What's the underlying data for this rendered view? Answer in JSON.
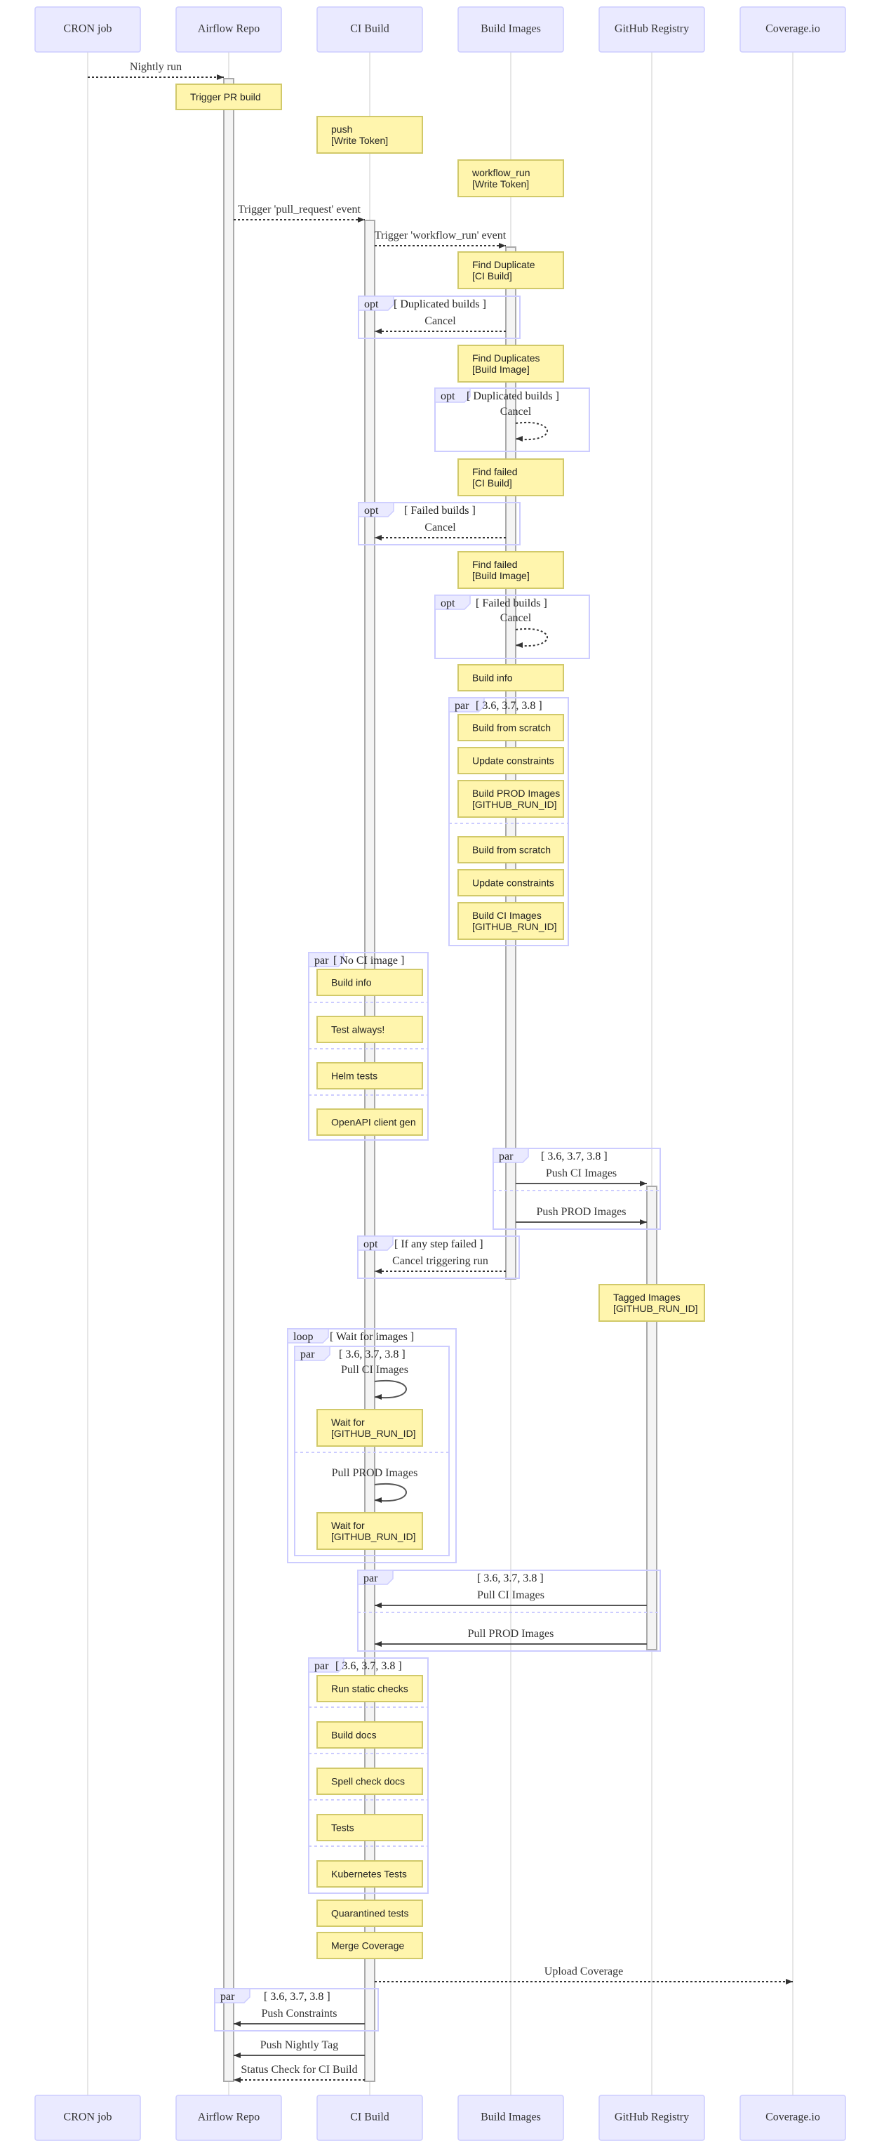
{
  "participants": [
    "CRON job",
    "Airflow Repo",
    "CI Build",
    "Build Images",
    "GitHub Registry",
    "Coverage.io"
  ],
  "messages": {
    "nightly_run": "Nightly run",
    "trigger_pr": "Trigger 'pull_request' event",
    "trigger_workflow": "Trigger 'workflow_run' event",
    "cancel": "Cancel",
    "push_ci_images": "Push CI Images",
    "push_prod_images": "Push PROD Images",
    "cancel_triggering_run": "Cancel triggering run",
    "pull_ci_images": "Pull CI Images",
    "pull_prod_images": "Pull PROD Images",
    "upload_coverage": "Upload Coverage",
    "push_constraints": "Push Constraints",
    "push_nightly_tag": "Push Nightly Tag",
    "status_check": "Status Check for CI Build"
  },
  "notes": {
    "trigger_pr_build": [
      "Trigger PR build"
    ],
    "push_write_token": [
      "push",
      "[Write Token]"
    ],
    "workflow_run_write_token": [
      "workflow_run",
      "[Write Token]"
    ],
    "find_duplicate_ci": [
      "Find Duplicate",
      "[CI Build]"
    ],
    "find_duplicates_image": [
      "Find Duplicates",
      "[Build Image]"
    ],
    "find_failed_ci": [
      "Find failed",
      "[CI Build]"
    ],
    "find_failed_image": [
      "Find failed",
      "[Build Image]"
    ],
    "build_info": [
      "Build info"
    ],
    "build_from_scratch": [
      "Build from scratch"
    ],
    "update_constraints": [
      "Update constraints"
    ],
    "build_prod_images": [
      "Build PROD Images",
      "[GITHUB_RUN_ID]"
    ],
    "build_ci_images": [
      "Build CI Images",
      "[GITHUB_RUN_ID]"
    ],
    "test_always": [
      "Test always!"
    ],
    "helm_tests": [
      "Helm tests"
    ],
    "openapi_client_gen": [
      "OpenAPI client gen"
    ],
    "tagged_images": [
      "Tagged Images",
      "[GITHUB_RUN_ID]"
    ],
    "wait_for": [
      "Wait for",
      "[GITHUB_RUN_ID]"
    ],
    "run_static_checks": [
      "Run static checks"
    ],
    "build_docs": [
      "Build docs"
    ],
    "spell_check_docs": [
      "Spell check docs"
    ],
    "tests": [
      "Tests"
    ],
    "kubernetes_tests": [
      "Kubernetes Tests"
    ],
    "quarantined_tests": [
      "Quarantined tests"
    ],
    "merge_coverage": [
      "Merge Coverage"
    ]
  },
  "frames": {
    "opt": "opt",
    "par": "par",
    "loop": "loop",
    "duplicated_builds": "[ Duplicated builds ]",
    "failed_builds": "[ Failed builds ]",
    "versions": "[ 3.6, 3.7, 3.8 ]",
    "no_ci_image": "[ No CI image ]",
    "if_any_step_failed": "[ If any step failed ]",
    "wait_for_images": "[ Wait for images ]"
  },
  "colors": {
    "actor_fill": "#eaeaff",
    "actor_stroke": "#ccccff",
    "note_fill": "#fff5ad",
    "note_stroke": "#d1c96a",
    "frame_stroke": "#ccccff"
  }
}
